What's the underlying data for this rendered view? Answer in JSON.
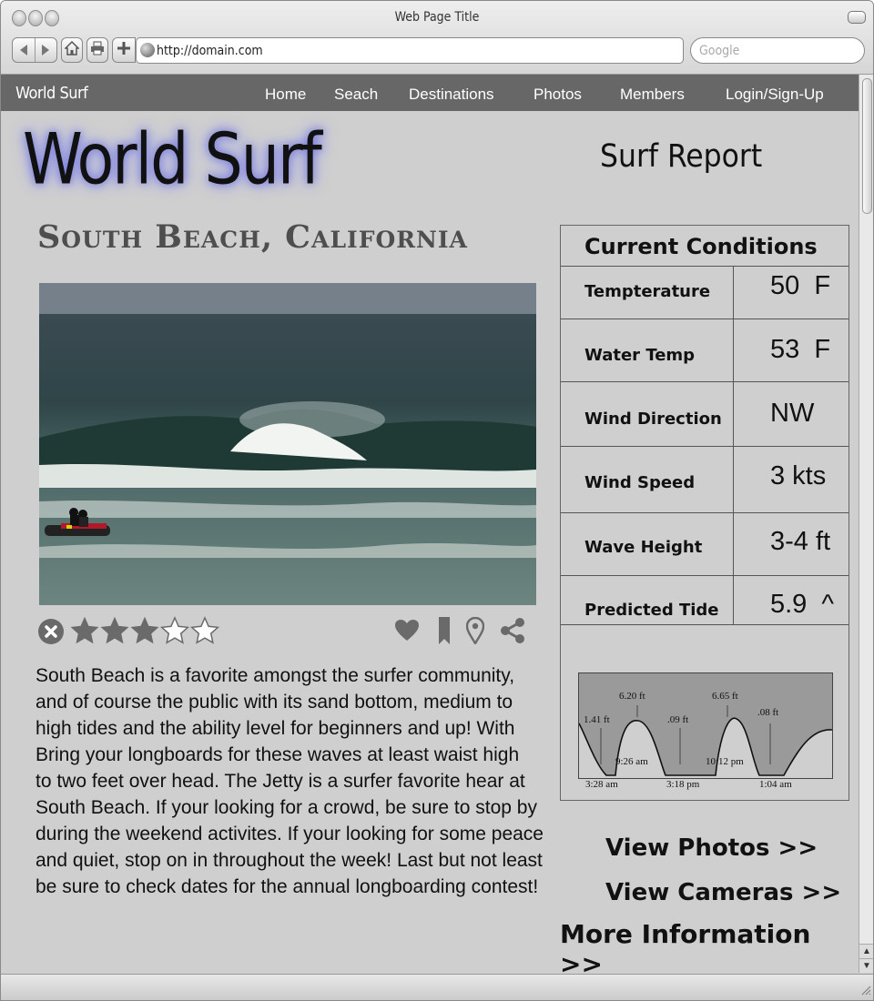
{
  "window": {
    "title": "Web Page Title"
  },
  "browser": {
    "url": "http://domain.com",
    "search_placeholder": "Google",
    "icons": [
      "back-icon",
      "forward-icon",
      "home-icon",
      "print-icon",
      "add-bookmark-icon"
    ]
  },
  "site_nav": {
    "brand": "World Surf",
    "items": [
      "Home",
      "Seach",
      "Destinations",
      "Photos",
      "Members",
      "Login/Sign-Up"
    ]
  },
  "logo": "World Surf",
  "location": "South Beach, California",
  "rating": {
    "stars": 3,
    "max": 5
  },
  "action_icons": [
    "heart-icon",
    "bookmark-icon",
    "location-pin-icon",
    "share-icon"
  ],
  "description": "South Beach is a favorite amongst the surfer community, and of course the public with its sand bottom, medium to high tides and the ability level for beginners and up! With Bring your longboards for these waves at least waist high to two feet over head. The Jetty is a surfer favorite hear at South Beach. If your looking for a crowd, be sure to stop by during the weekend activites. If your looking for some peace and quiet, stop on in throughout the week! Last but not least be sure to check dates for the annual longboarding contest!",
  "description_lines": [
    "South Beach is a favorite amongst the surfer community,",
    "and of course the public with its sand bottom, medium to",
    "high tides and the ability level for beginners and up! With",
    "Bring your longboards for these waves at least waist high",
    "to two feet over head. The Jetty is a surfer favorite hear at",
    "South Beach. If your looking for a crowd, be sure to stop by",
    "during the weekend activites. If your looking for some peace",
    "and quiet, stop on in throughout the week! Last but not least",
    "be sure to check dates for the annual longboarding contest!"
  ],
  "report": {
    "title": "Surf Report",
    "conditions_title": "Current Conditions",
    "conditions": [
      {
        "label": "Tempterature",
        "value": "50  F"
      },
      {
        "label": "Water Temp",
        "value": "53  F"
      },
      {
        "label": "Wind Direction",
        "value": "NW"
      },
      {
        "label": "Wind Speed",
        "value": "3 kts"
      },
      {
        "label": "Wave Height",
        "value": "3-4 ft"
      },
      {
        "label": "Predicted Tide",
        "value": "5.9  ^"
      }
    ],
    "tide_chart": {
      "peak_labels": [
        "1.41 ft",
        "6.20 ft",
        ".09 ft",
        "6.65 ft",
        ".08 ft"
      ],
      "inner_labels": [
        "9:26 am",
        "10:12 pm"
      ],
      "time_labels": [
        "3:28 am",
        "3:18 pm",
        "1:04 am"
      ]
    }
  },
  "links": {
    "photos": "View Photos >>",
    "cameras": "View Cameras >>",
    "more": "More Information >>"
  }
}
